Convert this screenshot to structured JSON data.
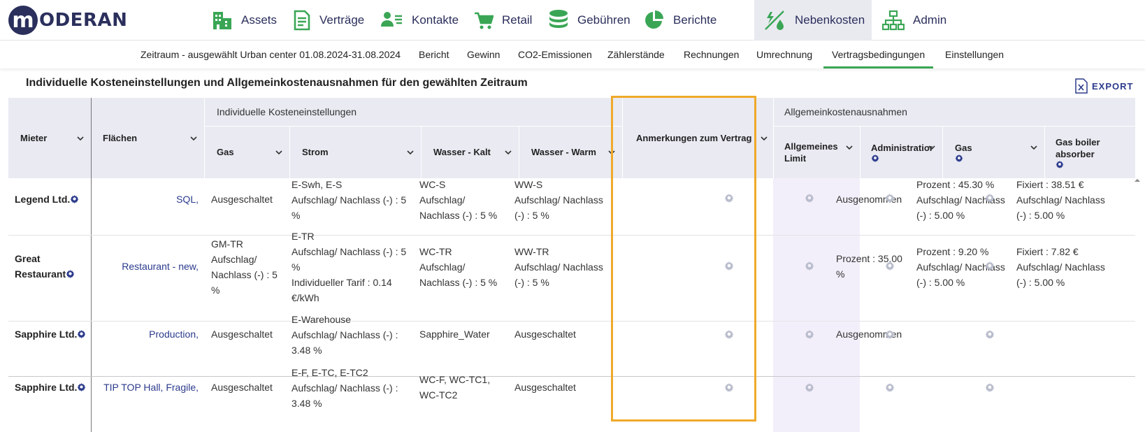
{
  "brand": {
    "letter": "m",
    "name": "ODERAN"
  },
  "nav": [
    {
      "label": "Assets",
      "icon": "building-icon"
    },
    {
      "label": "Verträge",
      "icon": "document-icon"
    },
    {
      "label": "Kontakte",
      "icon": "contacts-icon"
    },
    {
      "label": "Retail",
      "icon": "cart-icon"
    },
    {
      "label": "Gebühren",
      "icon": "coins-icon"
    },
    {
      "label": "Berichte",
      "icon": "pie-chart-icon"
    },
    {
      "label": "Nebenkosten",
      "icon": "utilities-icon",
      "active": true
    },
    {
      "label": "Admin",
      "icon": "org-chart-icon"
    }
  ],
  "subnav": {
    "period": "Zeitraum - ausgewählt Urban center 01.08.2024-31.08.2024",
    "items": [
      "Bericht",
      "Gewinn",
      "CO2-Emissionen",
      "Zählerstände",
      "Rechnungen",
      "Umrechnung",
      "Vertragsbedingungen",
      "Einstellungen"
    ],
    "active": "Vertragsbedingungen"
  },
  "page_title": "Individuelle Kosteneinstellungen und Allgemeinkostenausnahmen für den gewählten Zeitraum",
  "export_label": "EXPORT",
  "table": {
    "group_individual": "Individuelle Kosteneinstellungen",
    "group_general": "Allgemeinkostenausnahmen",
    "headers": {
      "mieter": "Mieter",
      "flaechen": "Flächen",
      "gas": "Gas",
      "strom": "Strom",
      "wasser_kalt": "Wasser - Kalt",
      "wasser_warm": "Wasser - Warm",
      "anmerkungen": "Anmerkungen zum Vertrag",
      "limit_1": "Allgemeines",
      "limit_2": "Limit",
      "administration": "Administration",
      "gas2": "Gas",
      "boiler_1": "Gas boiler",
      "boiler_2": "absorber"
    },
    "rows": [
      {
        "mieter": [
          "Legend Ltd."
        ],
        "flaechen": "SQL,",
        "gas": [
          "Ausgeschaltet"
        ],
        "strom": [
          "E-Swh, E-S",
          "Aufschlag/ Nachlass (-) : 5",
          "%"
        ],
        "wasser_kalt": [
          "WC-S",
          "Aufschlag/",
          "Nachlass (-) : 5 %"
        ],
        "wasser_warm": [
          "WW-S",
          "Aufschlag/ Nachlass",
          "(-) : 5 %"
        ],
        "administration": [
          "Ausgenommen"
        ],
        "gas2": [
          "Prozent : 45.30 %",
          "Aufschlag/ Nachlass",
          "(-) : 5.00 %"
        ],
        "boiler": [
          "Fixiert : 38.51 €",
          "Aufschlag/ Nachlass",
          "(-) : 5.00 %"
        ]
      },
      {
        "mieter": [
          "Great",
          "Restaurant"
        ],
        "flaechen": "Restaurant - new,",
        "gas": [
          "GM-TR",
          "Aufschlag/",
          "Nachlass (-) : 5",
          "%"
        ],
        "strom": [
          "E-TR",
          "Aufschlag/ Nachlass (-) : 5",
          "%",
          "Individueller Tarif : 0.14",
          "€/kWh"
        ],
        "wasser_kalt": [
          "WC-TR",
          "Aufschlag/",
          "Nachlass (-) : 5 %"
        ],
        "wasser_warm": [
          "WW-TR",
          "Aufschlag/ Nachlass",
          "(-) : 5 %"
        ],
        "administration": [
          "Prozent : 35.00",
          "%"
        ],
        "gas2": [
          "Prozent : 9.20 %",
          "Aufschlag/ Nachlass",
          "(-) : 5.00 %"
        ],
        "boiler": [
          "Fixiert : 7.82 €",
          "Aufschlag/ Nachlass",
          "(-) : 5.00 %"
        ]
      },
      {
        "mieter": [
          "Sapphire Ltd."
        ],
        "flaechen": "Production,",
        "gas": [
          "Ausgeschaltet"
        ],
        "strom": [
          "E-Warehouse",
          "Aufschlag/ Nachlass (-) :",
          "3.48 %"
        ],
        "wasser_kalt": [
          "Sapphire_Water"
        ],
        "wasser_warm": [
          "Ausgeschaltet"
        ],
        "administration": [
          "Ausgenommen"
        ],
        "gas2": [],
        "boiler": []
      },
      {
        "mieter": [
          "Sapphire Ltd."
        ],
        "flaechen": "TIP TOP Hall, Fragile,",
        "gas": [
          "Ausgeschaltet"
        ],
        "strom": [
          "E-F, E-TC, E-TC2",
          "Aufschlag/ Nachlass (-) :",
          "3.48 %"
        ],
        "wasser_kalt": [
          "WC-F, WC-TC1,",
          "WC-TC2"
        ],
        "wasser_warm": [
          "Ausgeschaltet"
        ],
        "administration": [],
        "gas2": [],
        "boiler": []
      }
    ]
  },
  "colors": {
    "brand": "#2b2f5c",
    "nav_icon": "#3aa655",
    "link": "#2b3a8c",
    "highlight": "#f0a92a",
    "header_bg": "#e9eaf2",
    "limit_bg": "#f3effa"
  }
}
